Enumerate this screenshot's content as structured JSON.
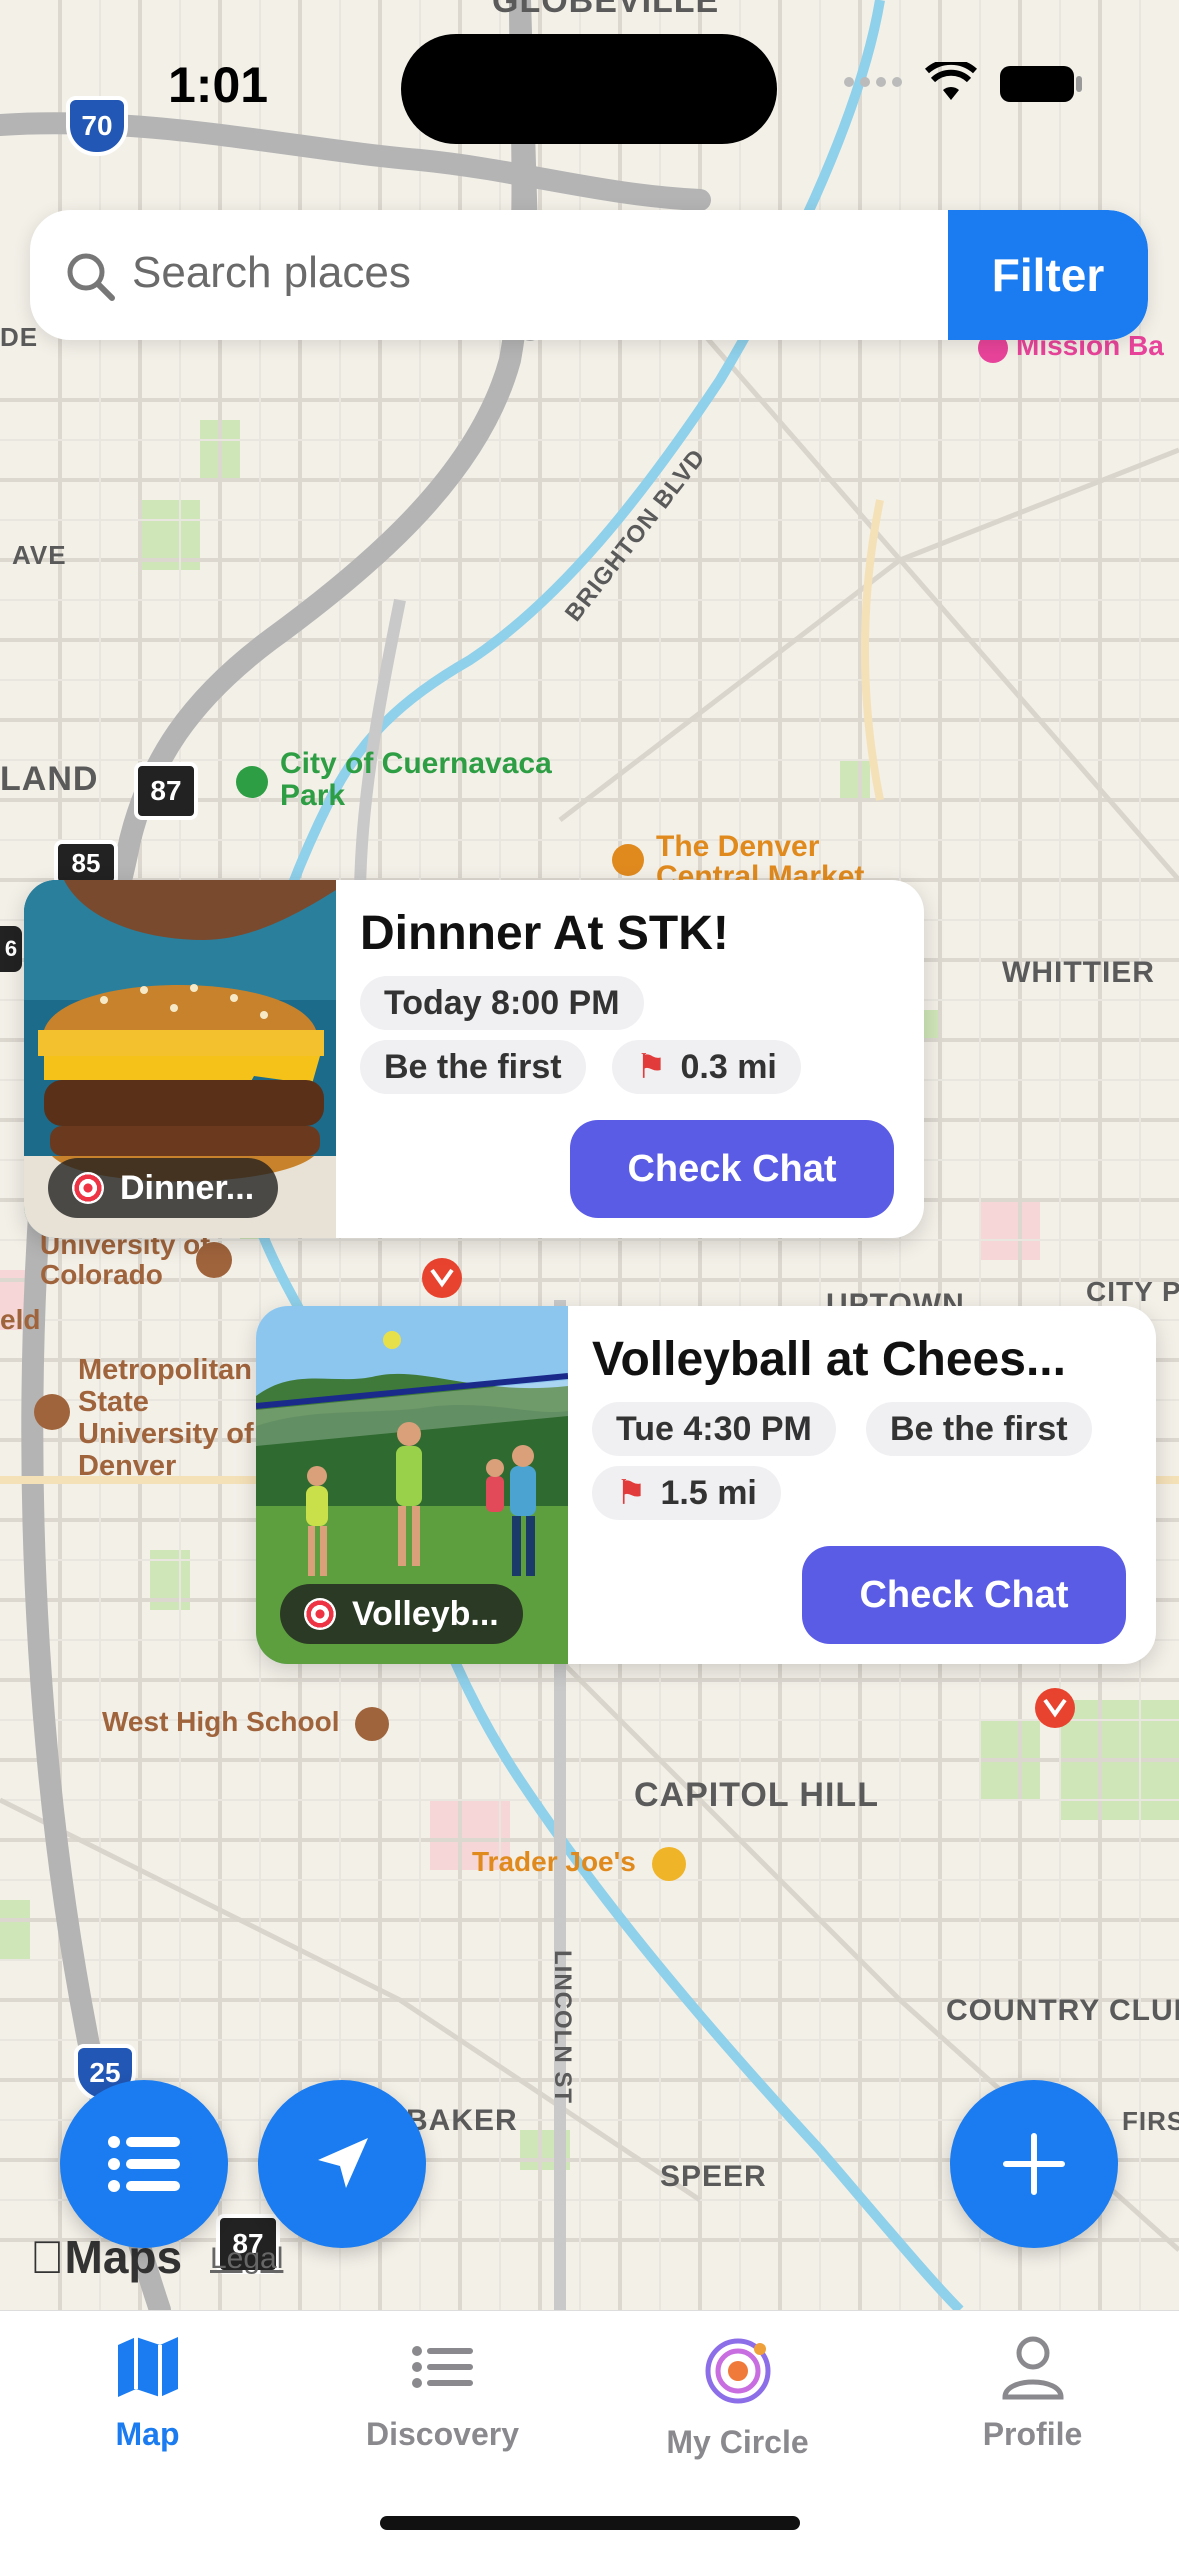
{
  "status": {
    "time": "1:01"
  },
  "search": {
    "placeholder": "Search places",
    "filter_label": "Filter"
  },
  "map": {
    "labels": [
      "GLOBEVILLE",
      "AVE",
      "LAND",
      "WHITTIER",
      "UPTOWN",
      "CITY PA",
      "CAPITOL HILL",
      "COUNTRY CLUB",
      "SPEER",
      "BAKER",
      "BRIGHTON BLVD",
      "LINCOLN ST",
      "FIRS",
      "DE"
    ],
    "pois": {
      "park": "City of Cuernavaca Park",
      "market": "The Denver Central Market",
      "mission": "Mission Ba",
      "university_colorado": "University of Colorado",
      "metro_state": "Metropolitan State University of Denver",
      "west_high": "West High School",
      "trader_joes": "Trader Joe's",
      "eld": "eld"
    },
    "shields": [
      "70",
      "87",
      "85",
      "25",
      "87",
      "6"
    ],
    "apple_maps": "Maps",
    "legal": "Legal"
  },
  "events": [
    {
      "title": "Dinnner At STK!",
      "tag": "Dinner...",
      "time": "Today 8:00 PM",
      "attendance": "Be the first",
      "distance": "0.3 mi",
      "button": "Check Chat"
    },
    {
      "title": "Volleyball at Chees...",
      "tag": "Volleyb...",
      "time": "Tue 4:30 PM",
      "attendance": "Be the first",
      "distance": "1.5 mi",
      "button": "Check Chat"
    }
  ],
  "tabs": [
    {
      "label": "Map",
      "icon": "map-icon",
      "active": true
    },
    {
      "label": "Discovery",
      "icon": "list-icon",
      "active": false
    },
    {
      "label": "My Circle",
      "icon": "circle-icon",
      "active": false
    },
    {
      "label": "Profile",
      "icon": "person-icon",
      "active": false
    }
  ],
  "colors": {
    "accent": "#1a7cf0",
    "chat_button": "#5b5ce6",
    "park": "#2e9e44",
    "poi_brown": "#a0643c",
    "poi_orange": "#e08a1e",
    "poi_pink": "#e8439a"
  }
}
